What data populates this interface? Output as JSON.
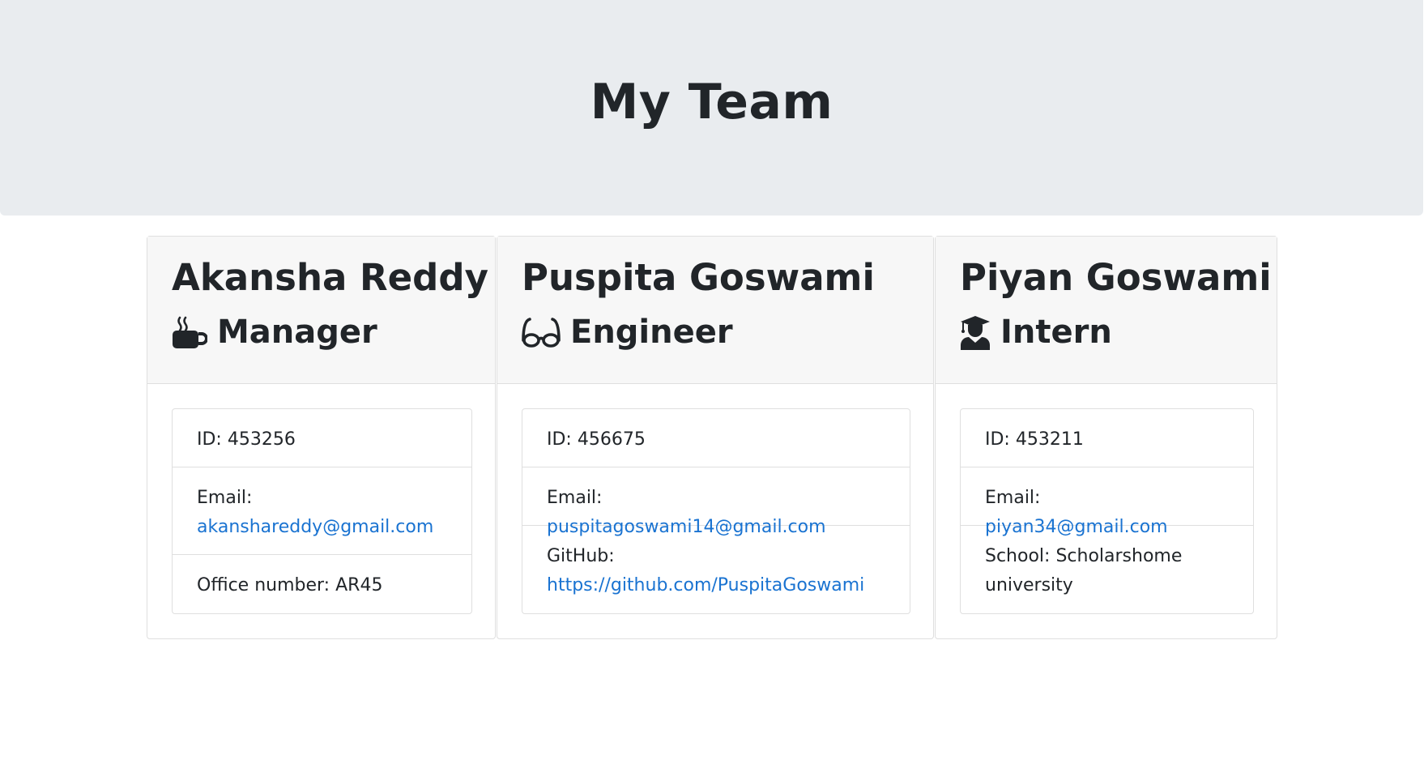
{
  "header": {
    "title": "My Team"
  },
  "colors": {
    "jumbotron_bg": "#e9ecef",
    "card_header_bg": "#f7f7f7",
    "link": "#1a73d1",
    "text": "#212529"
  },
  "cards": [
    {
      "name": "Akansha Reddy",
      "role": "Manager",
      "role_icon": "coffee-icon",
      "id_label": "ID:",
      "id": "453256",
      "email_label": "Email:",
      "email": "akanshareddy@gmail.com",
      "extra_label": "Office number:",
      "extra_value": "AR45"
    },
    {
      "name": "Puspita Goswami",
      "role": "Engineer",
      "role_icon": "glasses-icon",
      "id_label": "ID:",
      "id": "456675",
      "email_label": "Email:",
      "email": "puspitagoswami14@gmail.com",
      "extra_label": "GitHub:",
      "extra_value": "https://github.com/PuspitaGoswami"
    },
    {
      "name": "Piyan Goswami",
      "role": "Intern",
      "role_icon": "graduate-icon",
      "id_label": "ID:",
      "id": "453211",
      "email_label": "Email:",
      "email": "piyan34@gmail.com",
      "extra_label": "School:",
      "extra_value": "Scholarshome university"
    }
  ]
}
